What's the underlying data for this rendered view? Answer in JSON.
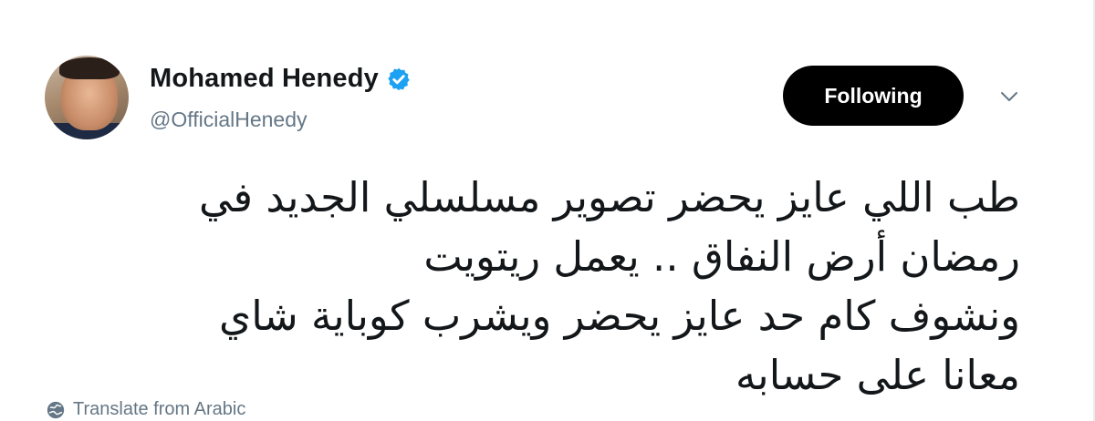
{
  "user": {
    "display_name": "Mohamed Henedy",
    "handle": "@OfficialHenedy",
    "verified": true
  },
  "actions": {
    "follow_label": "Following"
  },
  "tweet": {
    "lines": [
      "طب اللي عايز يحضر تصوير مسلسلي الجديد في",
      "رمضان أرض النفاق .. يعمل ريتويت",
      "ونشوف كام حد عايز يحضر ويشرب كوباية شاي",
      "معانا على حسابه"
    ]
  },
  "translate": {
    "label": "Translate from Arabic"
  },
  "icons": {
    "verified": "verified-badge-icon",
    "caret": "chevron-down-icon",
    "globe": "globe-icon"
  },
  "colors": {
    "verified_blue": "#1da1f2",
    "button_bg": "#000000",
    "secondary_text": "#657786",
    "primary_text": "#14171a"
  }
}
